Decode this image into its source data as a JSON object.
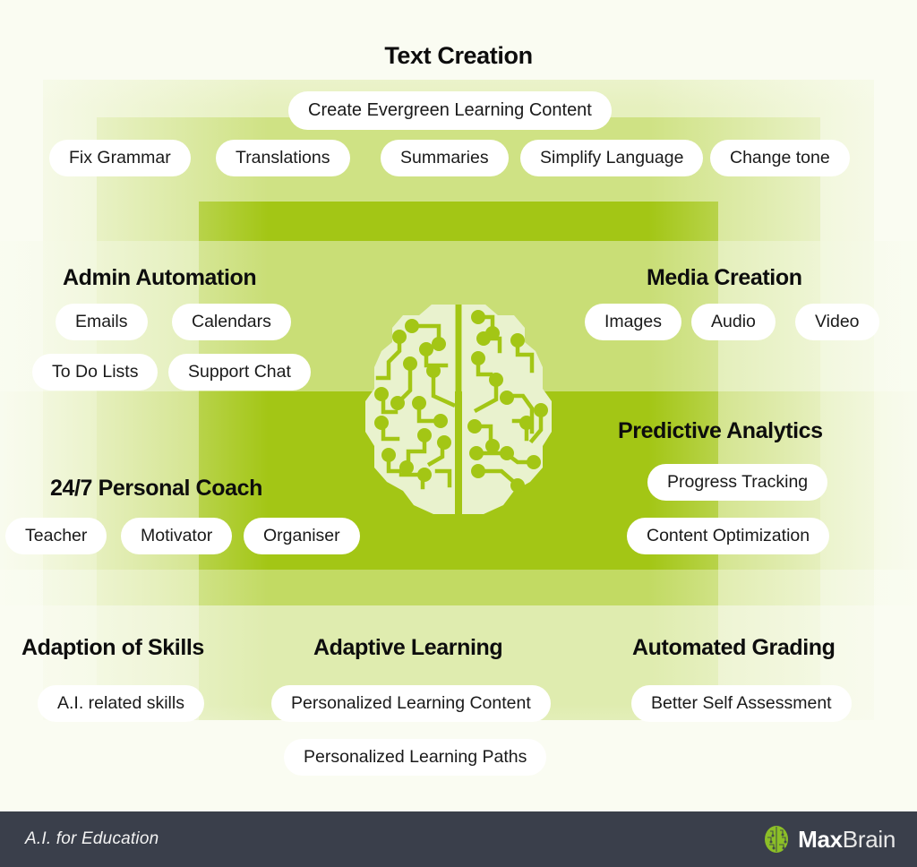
{
  "meta": {
    "accent_green": "#A3C615",
    "mid_green": "#C0D95E",
    "pale_green": "#E4EFB8",
    "bg_cream": "#FAFCF2",
    "footer_bg": "#3A3F4B",
    "pill_bg": "#FFFFFF",
    "heading_color": "#0D0D0D"
  },
  "sections": {
    "text_creation": {
      "title": "Text Creation",
      "pills": [
        "Create Evergreen Learning Content",
        "Fix Grammar",
        "Translations",
        "Summaries",
        "Simplify Language",
        "Change tone"
      ]
    },
    "admin_automation": {
      "title": "Admin Automation",
      "pills": [
        "Emails",
        "Calendars",
        "To Do Lists",
        "Support Chat"
      ]
    },
    "media_creation": {
      "title": "Media Creation",
      "pills": [
        "Images",
        "Audio",
        "Video"
      ]
    },
    "predictive_analytics": {
      "title": "Predictive Analytics",
      "pills": [
        "Progress Tracking",
        "Content Optimization"
      ]
    },
    "personal_coach": {
      "title": "24/7 Personal Coach",
      "pills": [
        "Teacher",
        "Motivator",
        "Organiser"
      ]
    },
    "adaption_of_skills": {
      "title": "Adaption of Skills",
      "pills": [
        "A.I. related skills"
      ]
    },
    "adaptive_learning": {
      "title": "Adaptive Learning",
      "pills": [
        "Personalized Learning Content",
        "Personalized Learning Paths"
      ]
    },
    "automated_grading": {
      "title": "Automated Grading",
      "pills": [
        "Better Self Assessment"
      ]
    }
  },
  "center": {
    "icon": "brain-circuit-icon"
  },
  "footer": {
    "tagline": "A.I. for Education",
    "logo_icon": "brain-logo-icon",
    "logo_bold": "Max",
    "logo_light": "Brain"
  }
}
